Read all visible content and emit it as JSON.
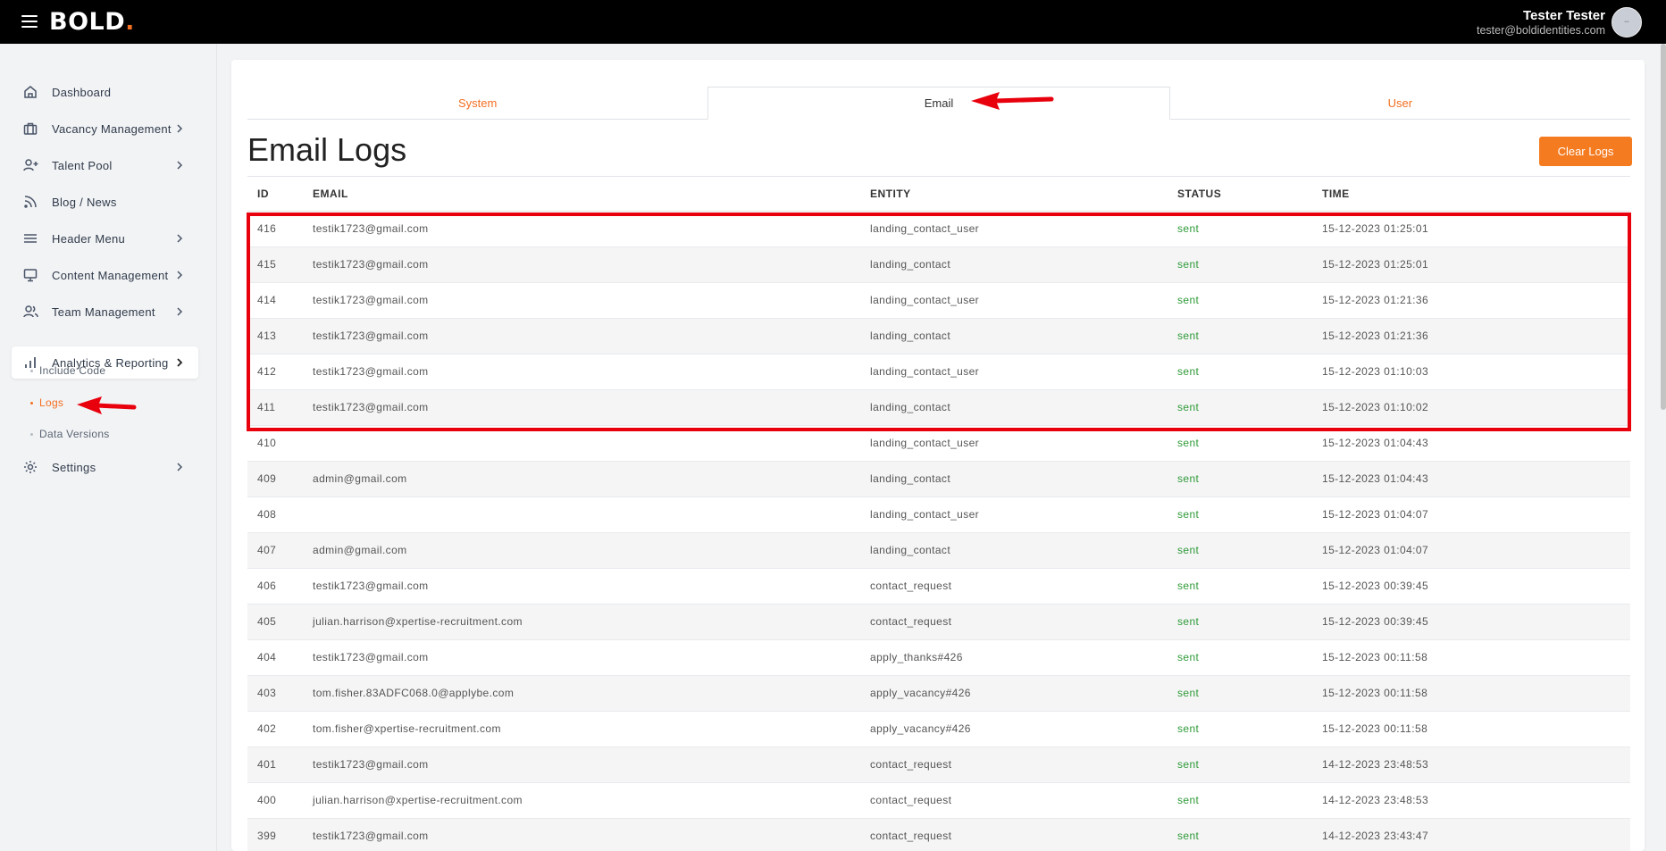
{
  "topbar": {
    "logo_text": "BOLD",
    "logo_dot": ".",
    "user_name": "Tester Tester",
    "user_email": "tester@boldidentities.com"
  },
  "sidebar": {
    "items": [
      {
        "label": "Dashboard",
        "icon": "home-icon"
      },
      {
        "label": "Vacancy Management",
        "icon": "briefcase-icon"
      },
      {
        "label": "Talent Pool",
        "icon": "user-plus-icon"
      },
      {
        "label": "Blog / News",
        "icon": "rss-icon"
      },
      {
        "label": "Header Menu",
        "icon": "menu-icon"
      },
      {
        "label": "Content Management",
        "icon": "monitor-icon"
      },
      {
        "label": "Team Management",
        "icon": "users-icon"
      },
      {
        "label": "Analytics & Reporting",
        "icon": "bar-chart-icon"
      },
      {
        "label": "Settings",
        "icon": "gear-icon"
      }
    ],
    "subitems": [
      {
        "label": "Include Code"
      },
      {
        "label": "Logs"
      },
      {
        "label": "Data Versions"
      }
    ]
  },
  "tabs": [
    {
      "label": "System"
    },
    {
      "label": "Email"
    },
    {
      "label": "User"
    }
  ],
  "page": {
    "title": "Email Logs",
    "clear_button": "Clear Logs"
  },
  "table": {
    "headers": [
      "ID",
      "EMAIL",
      "ENTITY",
      "STATUS",
      "TIME"
    ],
    "rows": [
      {
        "id": "416",
        "email": "testik1723@gmail.com",
        "entity": "landing_contact_user",
        "status": "sent",
        "time": "15-12-2023 01:25:01"
      },
      {
        "id": "415",
        "email": "testik1723@gmail.com",
        "entity": "landing_contact",
        "status": "sent",
        "time": "15-12-2023 01:25:01"
      },
      {
        "id": "414",
        "email": "testik1723@gmail.com",
        "entity": "landing_contact_user",
        "status": "sent",
        "time": "15-12-2023 01:21:36"
      },
      {
        "id": "413",
        "email": "testik1723@gmail.com",
        "entity": "landing_contact",
        "status": "sent",
        "time": "15-12-2023 01:21:36"
      },
      {
        "id": "412",
        "email": "testik1723@gmail.com",
        "entity": "landing_contact_user",
        "status": "sent",
        "time": "15-12-2023 01:10:03"
      },
      {
        "id": "411",
        "email": "testik1723@gmail.com",
        "entity": "landing_contact",
        "status": "sent",
        "time": "15-12-2023 01:10:02"
      },
      {
        "id": "410",
        "email": "",
        "entity": "landing_contact_user",
        "status": "sent",
        "time": "15-12-2023 01:04:43"
      },
      {
        "id": "409",
        "email": "admin@gmail.com",
        "entity": "landing_contact",
        "status": "sent",
        "time": "15-12-2023 01:04:43"
      },
      {
        "id": "408",
        "email": "",
        "entity": "landing_contact_user",
        "status": "sent",
        "time": "15-12-2023 01:04:07"
      },
      {
        "id": "407",
        "email": "admin@gmail.com",
        "entity": "landing_contact",
        "status": "sent",
        "time": "15-12-2023 01:04:07"
      },
      {
        "id": "406",
        "email": "testik1723@gmail.com",
        "entity": "contact_request",
        "status": "sent",
        "time": "15-12-2023 00:39:45"
      },
      {
        "id": "405",
        "email": "julian.harrison@xpertise-recruitment.com",
        "entity": "contact_request",
        "status": "sent",
        "time": "15-12-2023 00:39:45"
      },
      {
        "id": "404",
        "email": "testik1723@gmail.com",
        "entity": "apply_thanks#426",
        "status": "sent",
        "time": "15-12-2023 00:11:58"
      },
      {
        "id": "403",
        "email": "tom.fisher.83ADFC068.0@applybe.com",
        "entity": "apply_vacancy#426",
        "status": "sent",
        "time": "15-12-2023 00:11:58"
      },
      {
        "id": "402",
        "email": "tom.fisher@xpertise-recruitment.com",
        "entity": "apply_vacancy#426",
        "status": "sent",
        "time": "15-12-2023 00:11:58"
      },
      {
        "id": "401",
        "email": "testik1723@gmail.com",
        "entity": "contact_request",
        "status": "sent",
        "time": "14-12-2023 23:48:53"
      },
      {
        "id": "400",
        "email": "julian.harrison@xpertise-recruitment.com",
        "entity": "contact_request",
        "status": "sent",
        "time": "14-12-2023 23:48:53"
      },
      {
        "id": "399",
        "email": "testik1723@gmail.com",
        "entity": "contact_request",
        "status": "sent",
        "time": "14-12-2023 23:43:47"
      }
    ]
  },
  "colors": {
    "accent": "#f36f21",
    "status_sent": "#2e9a37",
    "annotation": "#e8000d"
  }
}
